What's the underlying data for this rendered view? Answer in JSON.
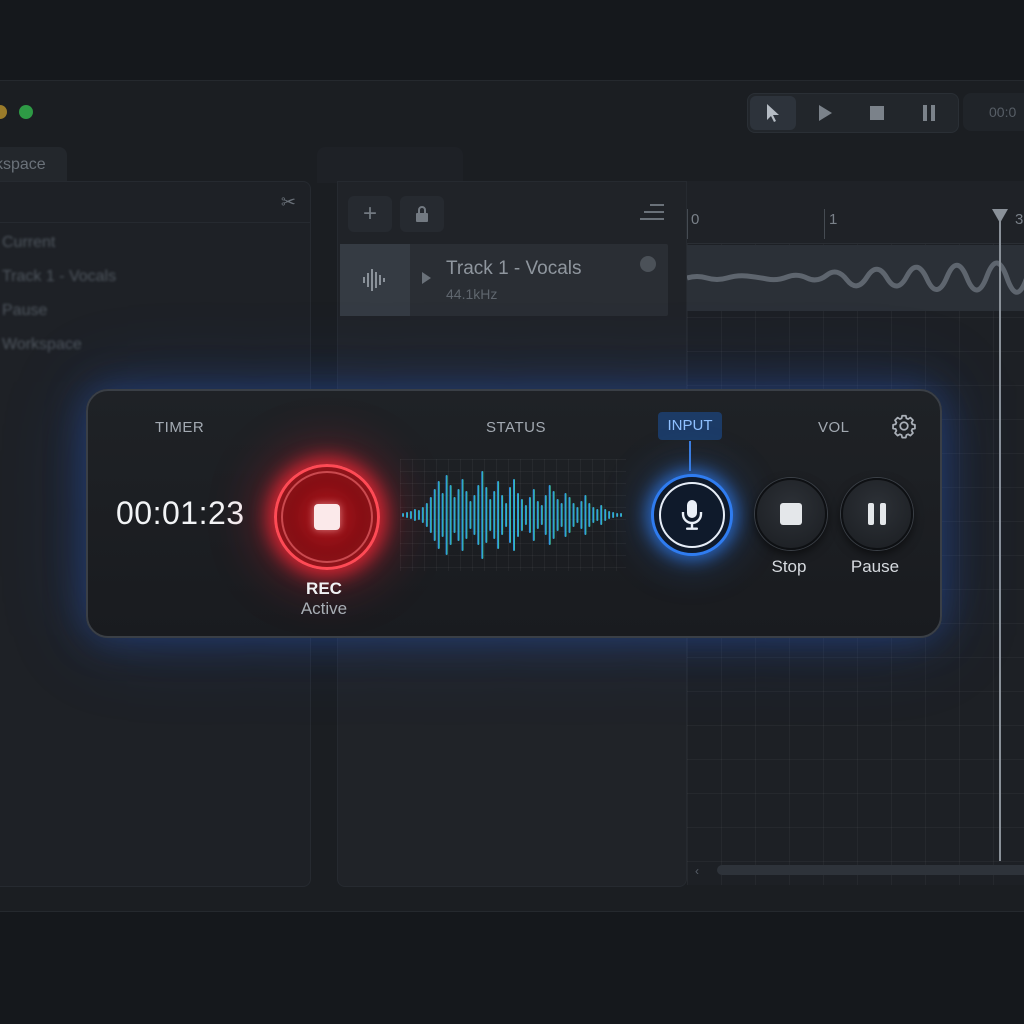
{
  "toolbar": {
    "tools": [
      {
        "icon": "cursor-icon",
        "active": true
      },
      {
        "icon": "play-icon",
        "active": false
      },
      {
        "icon": "stop-icon",
        "active": false
      },
      {
        "icon": "pause-icon",
        "active": false
      }
    ],
    "time_display": "00:0"
  },
  "sidebar": {
    "tab_label": "kspace",
    "items": [
      "Current",
      "Track 1 - Vocals",
      "Pause",
      "Workspace"
    ]
  },
  "tracks": [
    {
      "name": "Track 1 - Vocals",
      "sample_rate": "44.1kHz"
    }
  ],
  "timeline": {
    "ticks": [
      "0",
      "1",
      "3"
    ]
  },
  "recorder": {
    "labels": {
      "timer": "TIMER",
      "status": "STATUS",
      "input": "INPUT",
      "volume": "VOL"
    },
    "timer_value": "00:01:23",
    "rec_label": "REC",
    "rec_status": "Active",
    "stop_label": "Stop",
    "pause_label": "Pause",
    "colors": {
      "record": "#ff2a36",
      "input": "#2f7cf0",
      "wave_start": "#2f7cf0",
      "wave_end": "#3fd08a"
    }
  }
}
